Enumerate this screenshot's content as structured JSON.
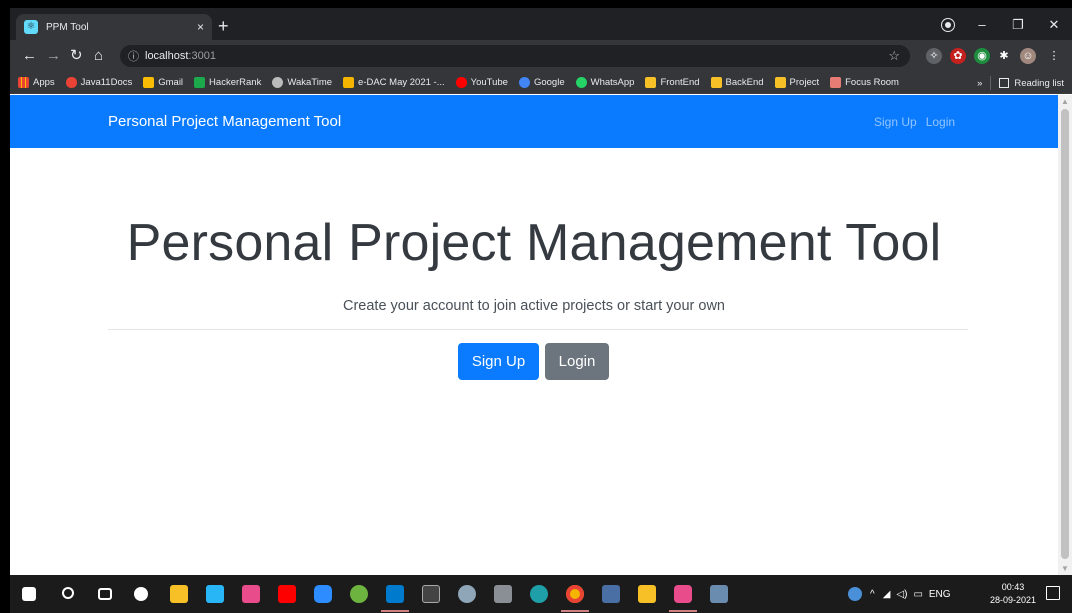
{
  "browser": {
    "tab_title": "PPM Tool",
    "tab_close": "×",
    "new_tab": "+",
    "url_host": "localhost",
    "url_port": ":3001",
    "info_icon": "ⓘ",
    "bookmarks": [
      {
        "label": "Apps",
        "color": "#ea4335"
      },
      {
        "label": "Java11Docs",
        "color": "#ea4335"
      },
      {
        "label": "Gmail",
        "color": "#fbbc05"
      },
      {
        "label": "HackerRank",
        "color": "#1ba94c"
      },
      {
        "label": "WakaTime",
        "color": "#bbbbbb"
      },
      {
        "label": "e-DAC May 2021 -...",
        "color": "#f4b400"
      },
      {
        "label": "YouTube",
        "color": "#ff0000"
      },
      {
        "label": "Google",
        "color": "#4285f4"
      },
      {
        "label": "WhatsApp",
        "color": "#25d366"
      },
      {
        "label": "FrontEnd",
        "color": "#f6c026"
      },
      {
        "label": "BackEnd",
        "color": "#f6c026"
      },
      {
        "label": "Project",
        "color": "#f6c026"
      },
      {
        "label": "Focus Room",
        "color": "#e67c73"
      }
    ],
    "bookmarks_overflow": "»",
    "reading_list": "Reading list"
  },
  "app": {
    "brand": "Personal Project Management Tool",
    "nav_signup": "Sign Up",
    "nav_login": "Login",
    "hero_title": "Personal Project Management Tool",
    "hero_lead": "Create your account to join active projects or start your own",
    "signup_button": "Sign Up",
    "login_button": "Login",
    "colors": {
      "primary": "#0a7bff",
      "secondary": "#6c757d"
    }
  },
  "taskbar": {
    "language": "ENG",
    "time": "00:43",
    "date": "28-09-2021"
  }
}
